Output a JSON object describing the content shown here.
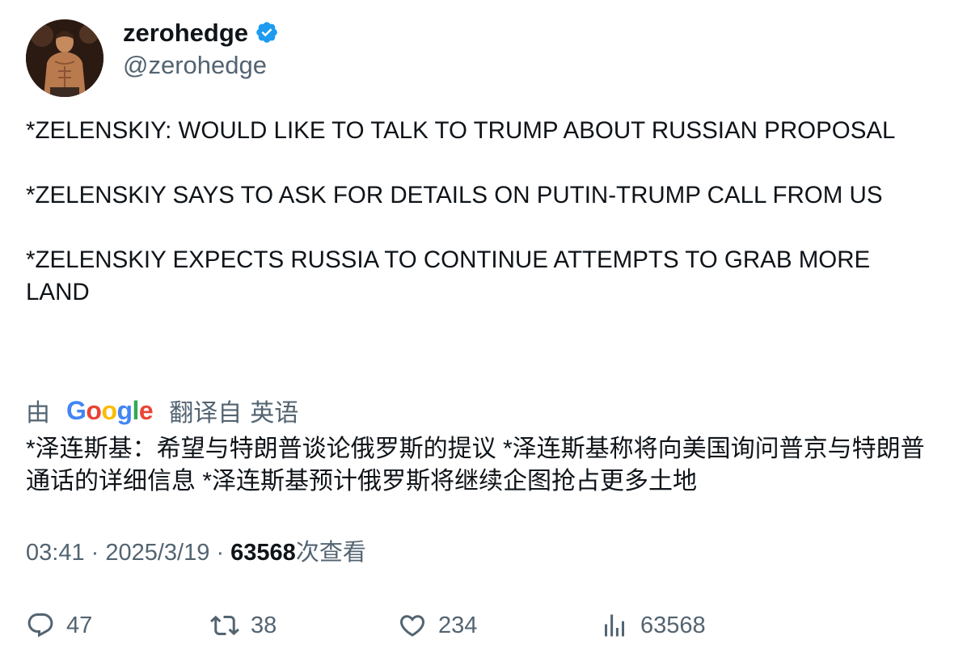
{
  "author": {
    "display_name": "zerohedge",
    "handle": "@zerohedge",
    "verified": true,
    "avatar_icon": "profile-photo"
  },
  "tweet": {
    "paragraphs": [
      "*ZELENSKIY: WOULD LIKE TO TALK TO TRUMP ABOUT RUSSIAN PROPOSAL",
      "*ZELENSKIY SAYS TO ASK FOR DETAILS ON PUTIN-TRUMP CALL FROM US",
      "*ZELENSKIY EXPECTS RUSSIA TO CONTINUE ATTEMPTS TO GRAB MORE LAND"
    ]
  },
  "translation": {
    "prefix": "由",
    "provider": "Google",
    "label": "翻译自",
    "source_language": "英语",
    "text": "*泽连斯基：希望与特朗普谈论俄罗斯的提议 *泽连斯基称将向美国询问普京与特朗普通话的详细信息 *泽连斯基预计俄罗斯将继续企图抢占更多土地"
  },
  "meta": {
    "time": "03:41",
    "date": "2025/3/19",
    "views": "63568",
    "views_label": "次查看"
  },
  "actions": {
    "replies": "47",
    "retweets": "38",
    "likes": "234",
    "views": "63568"
  },
  "colors": {
    "text": "#0f1419",
    "secondary": "#536471",
    "verified_blue": "#1d9bf0"
  }
}
